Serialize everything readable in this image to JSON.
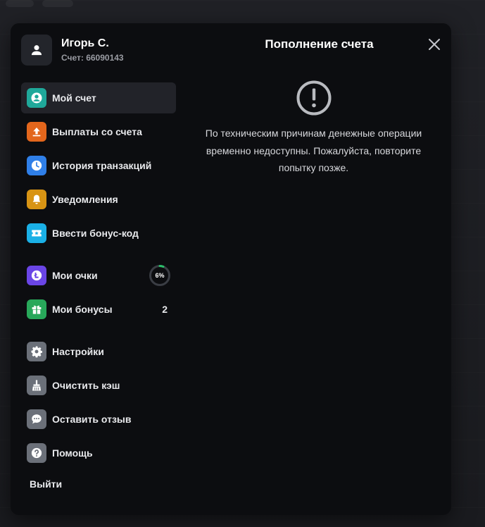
{
  "profile": {
    "name": "Игорь С.",
    "account": "Счет: 66090143"
  },
  "menu": {
    "items": [
      {
        "label": "Мой счет",
        "icon": "user-circle-icon",
        "color": "#1fa89a"
      },
      {
        "label": "Выплаты со счета",
        "icon": "upload-arrow-icon",
        "color": "#e3661c"
      },
      {
        "label": "История транзакций",
        "icon": "clock-icon",
        "color": "#2f7fe8"
      },
      {
        "label": "Уведомления",
        "icon": "bell-icon",
        "color": "#d89414"
      },
      {
        "label": "Ввести бонус-код",
        "icon": "ticket-icon",
        "color": "#1ab0e6"
      },
      {
        "label": "Мои очки",
        "icon": "points-coin-icon",
        "color": "#6a45e6",
        "progress_text": "6%",
        "progress": 0.06
      },
      {
        "label": "Мои бонусы",
        "icon": "gift-icon",
        "color": "#28a85a",
        "count": "2"
      },
      {
        "label": "Настройки",
        "icon": "gear-icon",
        "color": "#6b7079"
      },
      {
        "label": "Очистить кэш",
        "icon": "broom-icon",
        "color": "#6b7079"
      },
      {
        "label": "Оставить отзыв",
        "icon": "chat-bubble-icon",
        "color": "#6b7079"
      },
      {
        "label": "Помощь",
        "icon": "help-question-icon",
        "color": "#6b7079"
      }
    ],
    "logout_label": "Выйти"
  },
  "content": {
    "title": "Пополнение счета",
    "alert_icon": "exclamation-circle-icon",
    "message": "По техническим причинам денежные операции временно недоступны. Пожалуйста, повторите попытку позже."
  },
  "colors": {
    "modal_bg": "#0c0d10",
    "active_item_bg": "#222329",
    "progress_accent": "#2bbf6a"
  }
}
